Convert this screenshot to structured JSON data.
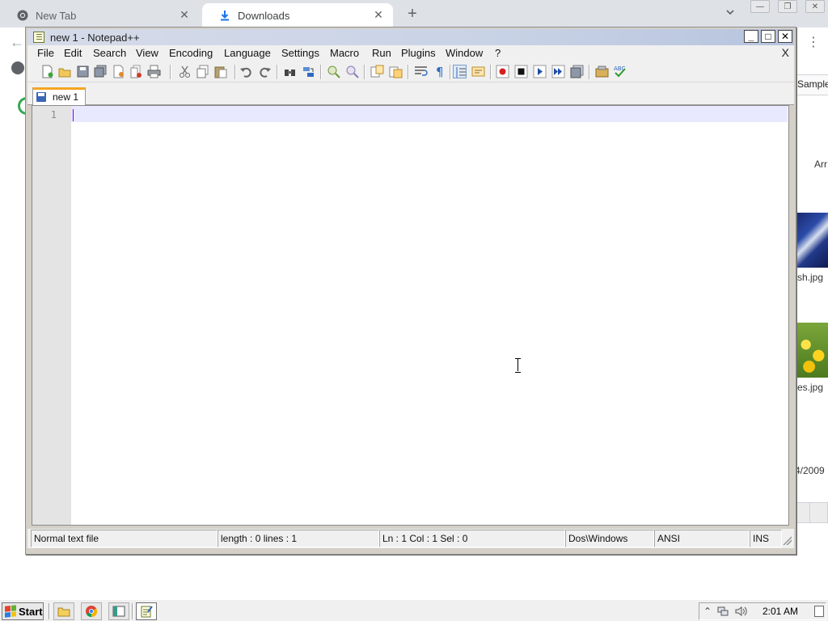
{
  "browser": {
    "tabs": [
      {
        "label": "New Tab"
      },
      {
        "label": "Downloads"
      }
    ],
    "side": {
      "menu_label": "⋮",
      "sample_label": "Sample",
      "arr_label": "Arr",
      "files": [
        "sh.jpg",
        "es.jpg"
      ],
      "date": "4/2009"
    }
  },
  "notepad": {
    "title": "new  1 - Notepad++",
    "menu": [
      "File",
      "Edit",
      "Search",
      "View",
      "Encoding",
      "Language",
      "Settings",
      "Macro",
      "Run",
      "Plugins",
      "Window",
      "?"
    ],
    "menu_close": "X",
    "tab_label": "new  1",
    "line_number": "1",
    "status": {
      "type": "Normal text file",
      "length_lines": "length : 0    lines : 1",
      "position": "Ln : 1    Col : 1    Sel : 0",
      "eol": "Dos\\Windows",
      "encoding": "ANSI",
      "mode": "INS"
    }
  },
  "taskbar": {
    "start_label": "Start",
    "clock": "2:01 AM"
  },
  "colors": {
    "current_line": "#e8e8ff",
    "caret": "#8000ff",
    "tab_accent": "#f5a623"
  }
}
